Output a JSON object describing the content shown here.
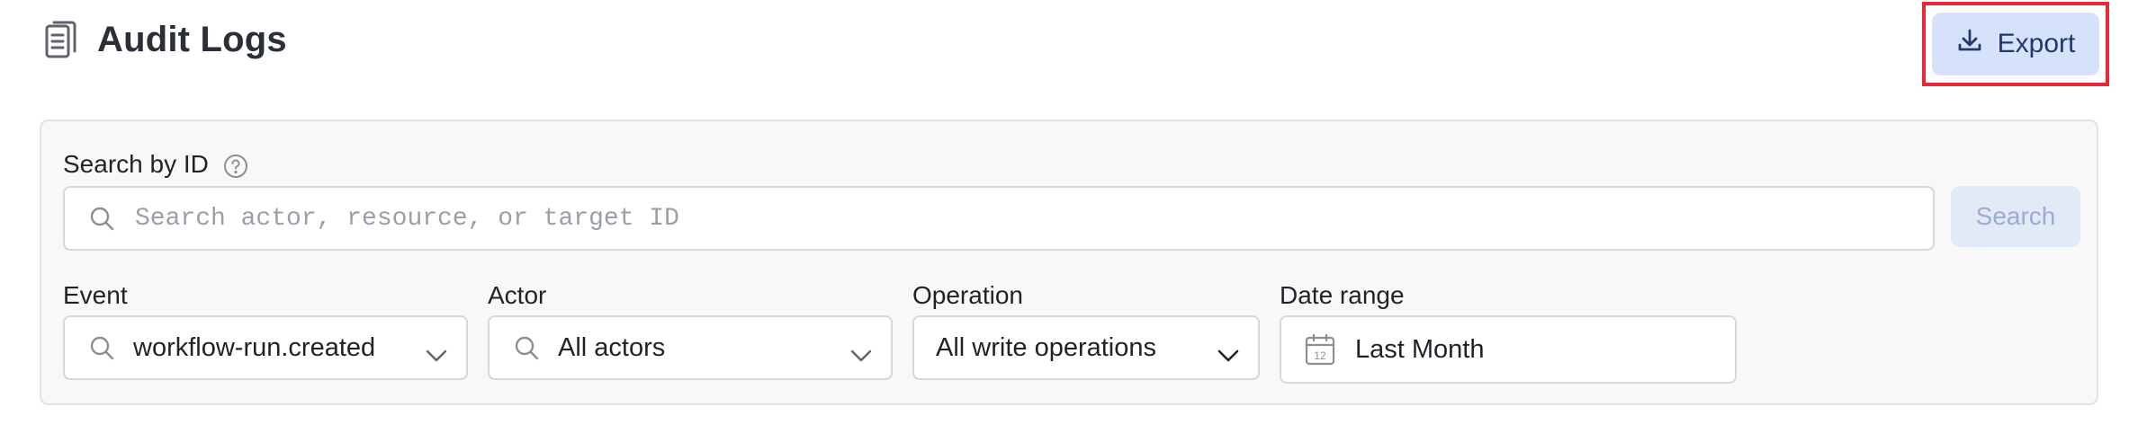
{
  "header": {
    "title": "Audit Logs",
    "title_icon": "clipboard-list-icon",
    "export_label": "Export",
    "export_icon": "download-icon"
  },
  "search": {
    "label": "Search by ID",
    "help_icon": "help-circle-icon",
    "placeholder": "Search actor, resource, or target ID",
    "value": "",
    "button_label": "Search"
  },
  "filters": {
    "event": {
      "label": "Event",
      "value": "workflow-run.created"
    },
    "actor": {
      "label": "Actor",
      "value": "All actors"
    },
    "operation": {
      "label": "Operation",
      "value": "All write operations"
    },
    "date_range": {
      "label": "Date range",
      "value": "Last Month",
      "calendar_day": "12"
    }
  },
  "colors": {
    "highlight_border": "#e5293b",
    "export_bg": "#d6e2fb",
    "export_text": "#24376b",
    "search_button_bg": "#e2e9f7",
    "search_button_text": "#9aabd4",
    "panel_bg": "#f8f8f8"
  }
}
